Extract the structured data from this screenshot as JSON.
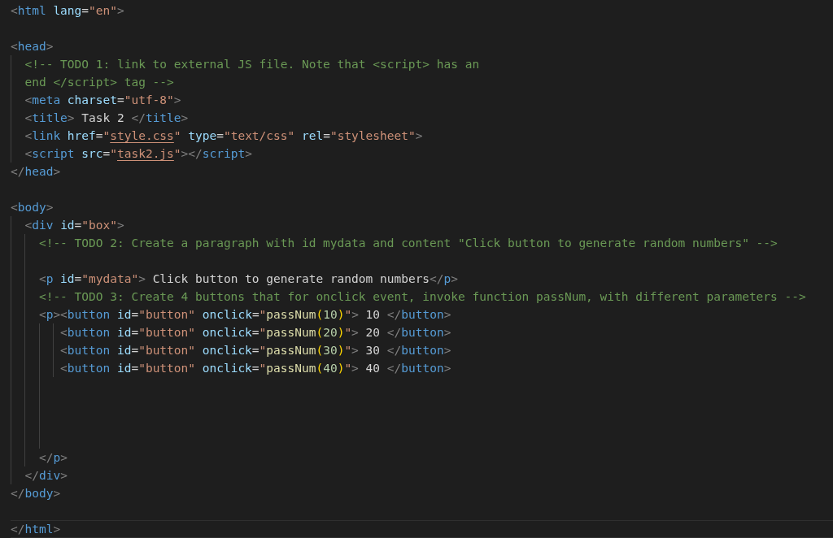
{
  "editor": {
    "lines": [
      {
        "current": false,
        "tokens": [
          {
            "kind": "punct",
            "text": "<"
          },
          {
            "kind": "tag",
            "text": "html"
          },
          {
            "kind": "attr",
            "text": " lang"
          },
          {
            "kind": "plain",
            "text": "="
          },
          {
            "kind": "string",
            "text": "\"en\""
          },
          {
            "kind": "punct",
            "text": ">"
          }
        ]
      },
      {
        "current": false
      },
      {
        "current": false,
        "tokens": [
          {
            "kind": "punct",
            "text": "<"
          },
          {
            "kind": "tag",
            "text": "head"
          },
          {
            "kind": "punct",
            "text": ">"
          }
        ]
      },
      {
        "current": false,
        "tokens": [
          {
            "kind": "comment",
            "text": "  <!-- TODO 1: link to external JS file. Note that <script> has an"
          }
        ]
      },
      {
        "current": false,
        "tokens": [
          {
            "kind": "comment",
            "text": "  end </script> tag -->"
          }
        ]
      },
      {
        "current": false,
        "tokens": [
          {
            "kind": "punct",
            "text": "  <"
          },
          {
            "kind": "tag",
            "text": "meta"
          },
          {
            "kind": "attr",
            "text": " charset"
          },
          {
            "kind": "plain",
            "text": "="
          },
          {
            "kind": "string",
            "text": "\"utf-8\""
          },
          {
            "kind": "punct",
            "text": ">"
          }
        ]
      },
      {
        "current": false,
        "tokens": [
          {
            "kind": "punct",
            "text": "  <"
          },
          {
            "kind": "tag",
            "text": "title"
          },
          {
            "kind": "punct",
            "text": ">"
          },
          {
            "kind": "plain",
            "text": " Task 2 "
          },
          {
            "kind": "punct",
            "text": "</"
          },
          {
            "kind": "tag",
            "text": "title"
          },
          {
            "kind": "punct",
            "text": ">"
          }
        ]
      },
      {
        "current": false,
        "tokens": [
          {
            "kind": "punct",
            "text": "  <"
          },
          {
            "kind": "tag",
            "text": "link"
          },
          {
            "kind": "attr",
            "text": " href"
          },
          {
            "kind": "plain",
            "text": "="
          },
          {
            "kind": "string",
            "text": "\""
          },
          {
            "kind": "link",
            "text": "style.css"
          },
          {
            "kind": "string",
            "text": "\""
          },
          {
            "kind": "attr",
            "text": " type"
          },
          {
            "kind": "plain",
            "text": "="
          },
          {
            "kind": "string",
            "text": "\"text/css\""
          },
          {
            "kind": "attr",
            "text": " rel"
          },
          {
            "kind": "plain",
            "text": "="
          },
          {
            "kind": "string",
            "text": "\"stylesheet\""
          },
          {
            "kind": "punct",
            "text": ">"
          }
        ]
      },
      {
        "current": false,
        "tokens": [
          {
            "kind": "punct",
            "text": "  <"
          },
          {
            "kind": "tag",
            "text": "script"
          },
          {
            "kind": "attr",
            "text": " src"
          },
          {
            "kind": "plain",
            "text": "="
          },
          {
            "kind": "string",
            "text": "\""
          },
          {
            "kind": "link",
            "text": "task2.js"
          },
          {
            "kind": "string",
            "text": "\""
          },
          {
            "kind": "punct",
            "text": "></"
          },
          {
            "kind": "tag",
            "text": "script"
          },
          {
            "kind": "punct",
            "text": ">"
          }
        ]
      },
      {
        "current": false,
        "tokens": [
          {
            "kind": "punct",
            "text": "</"
          },
          {
            "kind": "tag",
            "text": "head"
          },
          {
            "kind": "punct",
            "text": ">"
          }
        ]
      },
      {
        "current": false
      },
      {
        "current": false,
        "tokens": [
          {
            "kind": "punct",
            "text": "<"
          },
          {
            "kind": "tag",
            "text": "body"
          },
          {
            "kind": "punct",
            "text": ">"
          }
        ]
      },
      {
        "current": false,
        "tokens": [
          {
            "kind": "punct",
            "text": "  <"
          },
          {
            "kind": "tag",
            "text": "div"
          },
          {
            "kind": "attr",
            "text": " id"
          },
          {
            "kind": "plain",
            "text": "="
          },
          {
            "kind": "string",
            "text": "\"box\""
          },
          {
            "kind": "punct",
            "text": ">"
          }
        ]
      },
      {
        "current": false,
        "tokens": [
          {
            "kind": "comment",
            "text": "    <!-- TODO 2: Create a paragraph with id mydata and content \"Click button to generate random numbers\" -->"
          }
        ]
      },
      {
        "current": false
      },
      {
        "current": false,
        "tokens": [
          {
            "kind": "punct",
            "text": "    <"
          },
          {
            "kind": "tag",
            "text": "p"
          },
          {
            "kind": "attr",
            "text": " id"
          },
          {
            "kind": "plain",
            "text": "="
          },
          {
            "kind": "string",
            "text": "\"mydata\""
          },
          {
            "kind": "punct",
            "text": ">"
          },
          {
            "kind": "plain",
            "text": " Click button to generate random numbers"
          },
          {
            "kind": "punct",
            "text": "</"
          },
          {
            "kind": "tag",
            "text": "p"
          },
          {
            "kind": "punct",
            "text": ">"
          }
        ]
      },
      {
        "current": false,
        "tokens": [
          {
            "kind": "comment",
            "text": "    <!-- TODO 3: Create 4 buttons that for onclick event, invoke function passNum, with different parameters -->"
          }
        ]
      },
      {
        "current": false,
        "tokens": [
          {
            "kind": "punct",
            "text": "    <"
          },
          {
            "kind": "tag",
            "text": "p"
          },
          {
            "kind": "punct",
            "text": "><"
          },
          {
            "kind": "tag",
            "text": "button"
          },
          {
            "kind": "attr",
            "text": " id"
          },
          {
            "kind": "plain",
            "text": "="
          },
          {
            "kind": "string",
            "text": "\"button\""
          },
          {
            "kind": "attr",
            "text": " onclick"
          },
          {
            "kind": "plain",
            "text": "="
          },
          {
            "kind": "string",
            "text": "\""
          },
          {
            "kind": "function",
            "text": "passNum"
          },
          {
            "kind": "paren",
            "text": "("
          },
          {
            "kind": "number",
            "text": "10"
          },
          {
            "kind": "paren",
            "text": ")"
          },
          {
            "kind": "string",
            "text": "\""
          },
          {
            "kind": "punct",
            "text": ">"
          },
          {
            "kind": "plain",
            "text": " 10 "
          },
          {
            "kind": "punct",
            "text": "</"
          },
          {
            "kind": "tag",
            "text": "button"
          },
          {
            "kind": "punct",
            "text": ">"
          }
        ]
      },
      {
        "current": false,
        "tokens": [
          {
            "kind": "punct",
            "text": "       <"
          },
          {
            "kind": "tag",
            "text": "button"
          },
          {
            "kind": "attr",
            "text": " id"
          },
          {
            "kind": "plain",
            "text": "="
          },
          {
            "kind": "string",
            "text": "\"button\""
          },
          {
            "kind": "attr",
            "text": " onclick"
          },
          {
            "kind": "plain",
            "text": "="
          },
          {
            "kind": "string",
            "text": "\""
          },
          {
            "kind": "function",
            "text": "passNum"
          },
          {
            "kind": "paren",
            "text": "("
          },
          {
            "kind": "number",
            "text": "20"
          },
          {
            "kind": "paren",
            "text": ")"
          },
          {
            "kind": "string",
            "text": "\""
          },
          {
            "kind": "punct",
            "text": ">"
          },
          {
            "kind": "plain",
            "text": " 20 "
          },
          {
            "kind": "punct",
            "text": "</"
          },
          {
            "kind": "tag",
            "text": "button"
          },
          {
            "kind": "punct",
            "text": ">"
          }
        ]
      },
      {
        "current": false,
        "tokens": [
          {
            "kind": "punct",
            "text": "       <"
          },
          {
            "kind": "tag",
            "text": "button"
          },
          {
            "kind": "attr",
            "text": " id"
          },
          {
            "kind": "plain",
            "text": "="
          },
          {
            "kind": "string",
            "text": "\"button\""
          },
          {
            "kind": "attr",
            "text": " onclick"
          },
          {
            "kind": "plain",
            "text": "="
          },
          {
            "kind": "string",
            "text": "\""
          },
          {
            "kind": "function",
            "text": "passNum"
          },
          {
            "kind": "paren",
            "text": "("
          },
          {
            "kind": "number",
            "text": "30"
          },
          {
            "kind": "paren",
            "text": ")"
          },
          {
            "kind": "string",
            "text": "\""
          },
          {
            "kind": "punct",
            "text": ">"
          },
          {
            "kind": "plain",
            "text": " 30 "
          },
          {
            "kind": "punct",
            "text": "</"
          },
          {
            "kind": "tag",
            "text": "button"
          },
          {
            "kind": "punct",
            "text": ">"
          }
        ]
      },
      {
        "current": false,
        "tokens": [
          {
            "kind": "punct",
            "text": "       <"
          },
          {
            "kind": "tag",
            "text": "button"
          },
          {
            "kind": "attr",
            "text": " id"
          },
          {
            "kind": "plain",
            "text": "="
          },
          {
            "kind": "string",
            "text": "\"button\""
          },
          {
            "kind": "attr",
            "text": " onclick"
          },
          {
            "kind": "plain",
            "text": "="
          },
          {
            "kind": "string",
            "text": "\""
          },
          {
            "kind": "function",
            "text": "passNum"
          },
          {
            "kind": "paren",
            "text": "("
          },
          {
            "kind": "number",
            "text": "40"
          },
          {
            "kind": "paren",
            "text": ")"
          },
          {
            "kind": "string",
            "text": "\""
          },
          {
            "kind": "punct",
            "text": ">"
          },
          {
            "kind": "plain",
            "text": " 40 "
          },
          {
            "kind": "punct",
            "text": "</"
          },
          {
            "kind": "tag",
            "text": "button"
          },
          {
            "kind": "punct",
            "text": ">"
          }
        ]
      },
      {
        "current": false
      },
      {
        "current": false
      },
      {
        "current": false
      },
      {
        "current": false
      },
      {
        "current": false,
        "tokens": [
          {
            "kind": "punct",
            "text": "    </"
          },
          {
            "kind": "tag",
            "text": "p"
          },
          {
            "kind": "punct",
            "text": ">"
          }
        ]
      },
      {
        "current": false,
        "tokens": [
          {
            "kind": "punct",
            "text": "  </"
          },
          {
            "kind": "tag",
            "text": "div"
          },
          {
            "kind": "punct",
            "text": ">"
          }
        ]
      },
      {
        "current": false,
        "tokens": [
          {
            "kind": "punct",
            "text": "</"
          },
          {
            "kind": "tag",
            "text": "body"
          },
          {
            "kind": "punct",
            "text": ">"
          }
        ]
      },
      {
        "current": false
      },
      {
        "current": true,
        "tokens": [
          {
            "kind": "punct",
            "text": "</"
          },
          {
            "kind": "tag",
            "text": "html"
          },
          {
            "kind": "punct",
            "text": ">"
          }
        ]
      }
    ]
  }
}
